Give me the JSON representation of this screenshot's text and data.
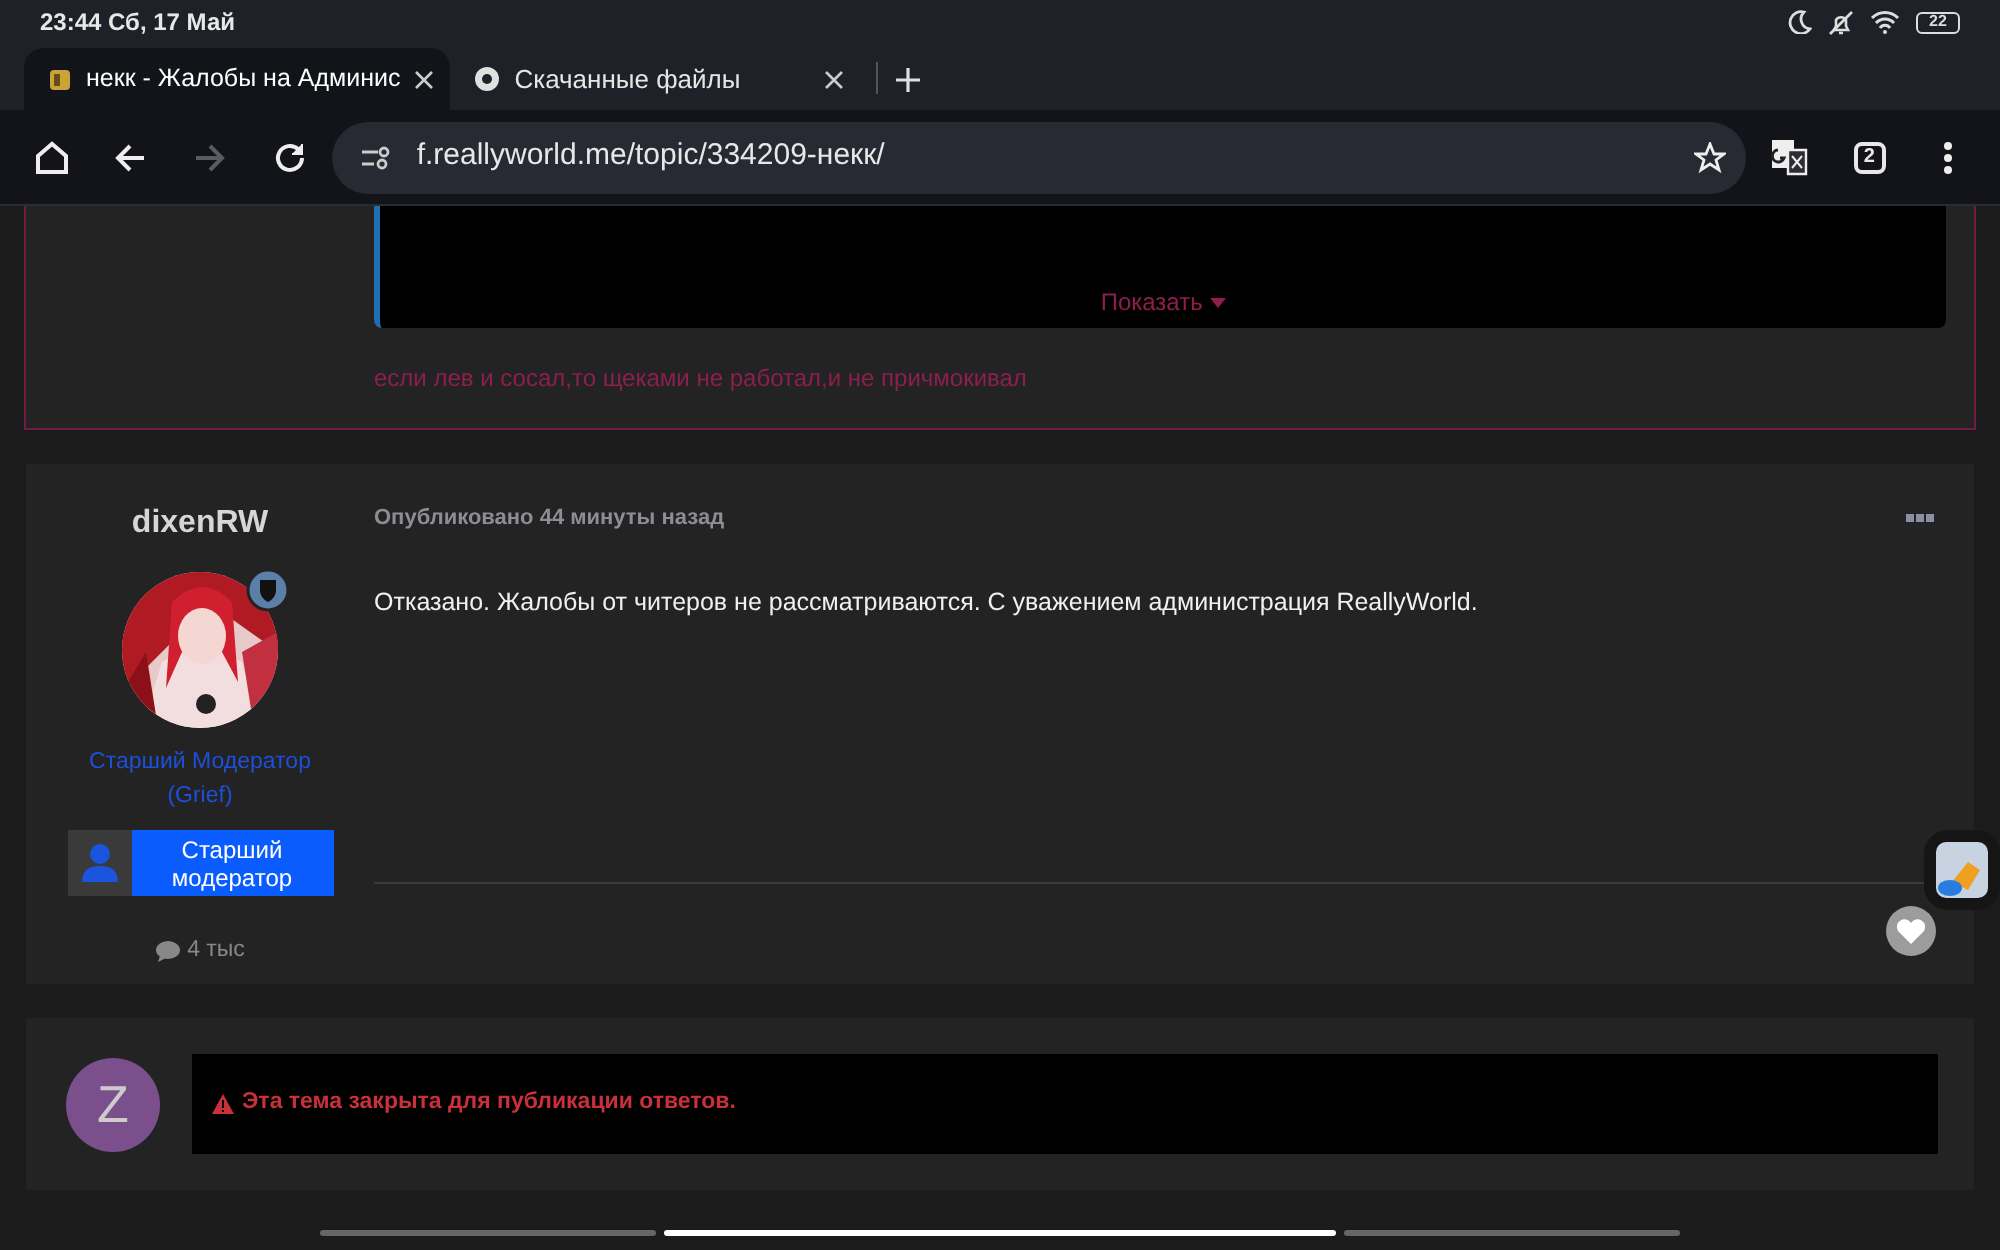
{
  "status_bar": {
    "time": "23:44 Сб, 17 Май",
    "battery": "22"
  },
  "tabs": [
    {
      "title": "некк - Жалобы на Админис",
      "selected": true
    },
    {
      "title": "Скачанные файлы",
      "selected": false
    }
  ],
  "toolbar": {
    "forward_disabled": true,
    "url": "f.reallyworld.me/topic/334209-некк/",
    "tab_count": "2"
  },
  "previous_post": {
    "spoiler_button": "Показать",
    "text": "если лев и сосал,то щеками не работал,и не причмокивал"
  },
  "post": {
    "author": "dixenRW",
    "group": "Старший Модератор (Grief)",
    "rank_badge": "Старший модератор",
    "post_count": "4 тыс",
    "meta": "Опубликовано 44 минуты назад",
    "body": "Отказано. Жалобы от читеров не рассматриваются. С уважением администрация ReallyWorld."
  },
  "closed_notice": {
    "avatar_letter": "Z",
    "message": "Эта тема закрыта для публикации ответов."
  }
}
